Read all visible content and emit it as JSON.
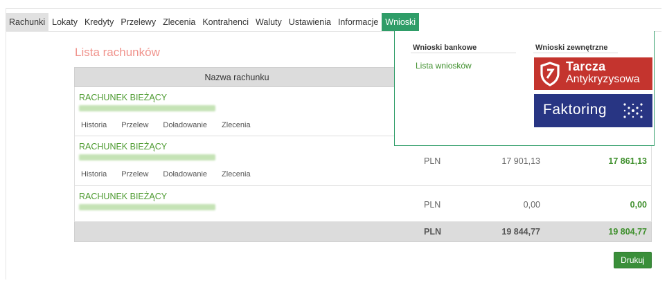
{
  "tabs": [
    {
      "label": "Rachunki",
      "state": "active"
    },
    {
      "label": "Lokaty",
      "state": ""
    },
    {
      "label": "Kredyty",
      "state": ""
    },
    {
      "label": "Przelewy",
      "state": ""
    },
    {
      "label": "Zlecenia",
      "state": ""
    },
    {
      "label": "Kontrahenci",
      "state": ""
    },
    {
      "label": "Waluty",
      "state": ""
    },
    {
      "label": "Ustawienia",
      "state": ""
    },
    {
      "label": "Informacje",
      "state": ""
    },
    {
      "label": "Wnioski",
      "state": "open"
    }
  ],
  "page": {
    "title": "Lista rachunków"
  },
  "table": {
    "header": {
      "name": "Nazwa rachunku"
    },
    "rows": [
      {
        "name": "RACHUNEK BIEŻĄCY",
        "actions": [
          "Historia",
          "Przelew",
          "Doładowanie",
          "Zlecenia"
        ],
        "currency": "",
        "balance": "",
        "available": ""
      },
      {
        "name": "RACHUNEK BIEŻĄCY",
        "actions": [
          "Historia",
          "Przelew",
          "Doładowanie",
          "Zlecenia"
        ],
        "currency": "PLN",
        "balance": "17 901,13",
        "available": "17 861,13"
      },
      {
        "name": "RACHUNEK BIEŻĄCY",
        "actions": [],
        "currency": "PLN",
        "balance": "0,00",
        "available": "0,00"
      }
    ],
    "total": {
      "currency": "PLN",
      "balance": "19 844,77",
      "available": "19 804,77"
    }
  },
  "print_button": {
    "label": "Drukuj"
  },
  "dropdown": {
    "bank_heading": "Wnioski bankowe",
    "external_heading": "Wnioski zewnętrzne",
    "bank_link": "Lista wniosków",
    "logo1_line1": "Tarcza",
    "logo1_line2": "Antykryzysowa",
    "logo2_text": "Faktoring"
  },
  "colors": {
    "accent_green": "#2f9d68",
    "link_green": "#3e8f2c",
    "title_salmon": "#f0938c",
    "tarcza_red": "#c4342e",
    "faktoring_navy": "#283583"
  }
}
